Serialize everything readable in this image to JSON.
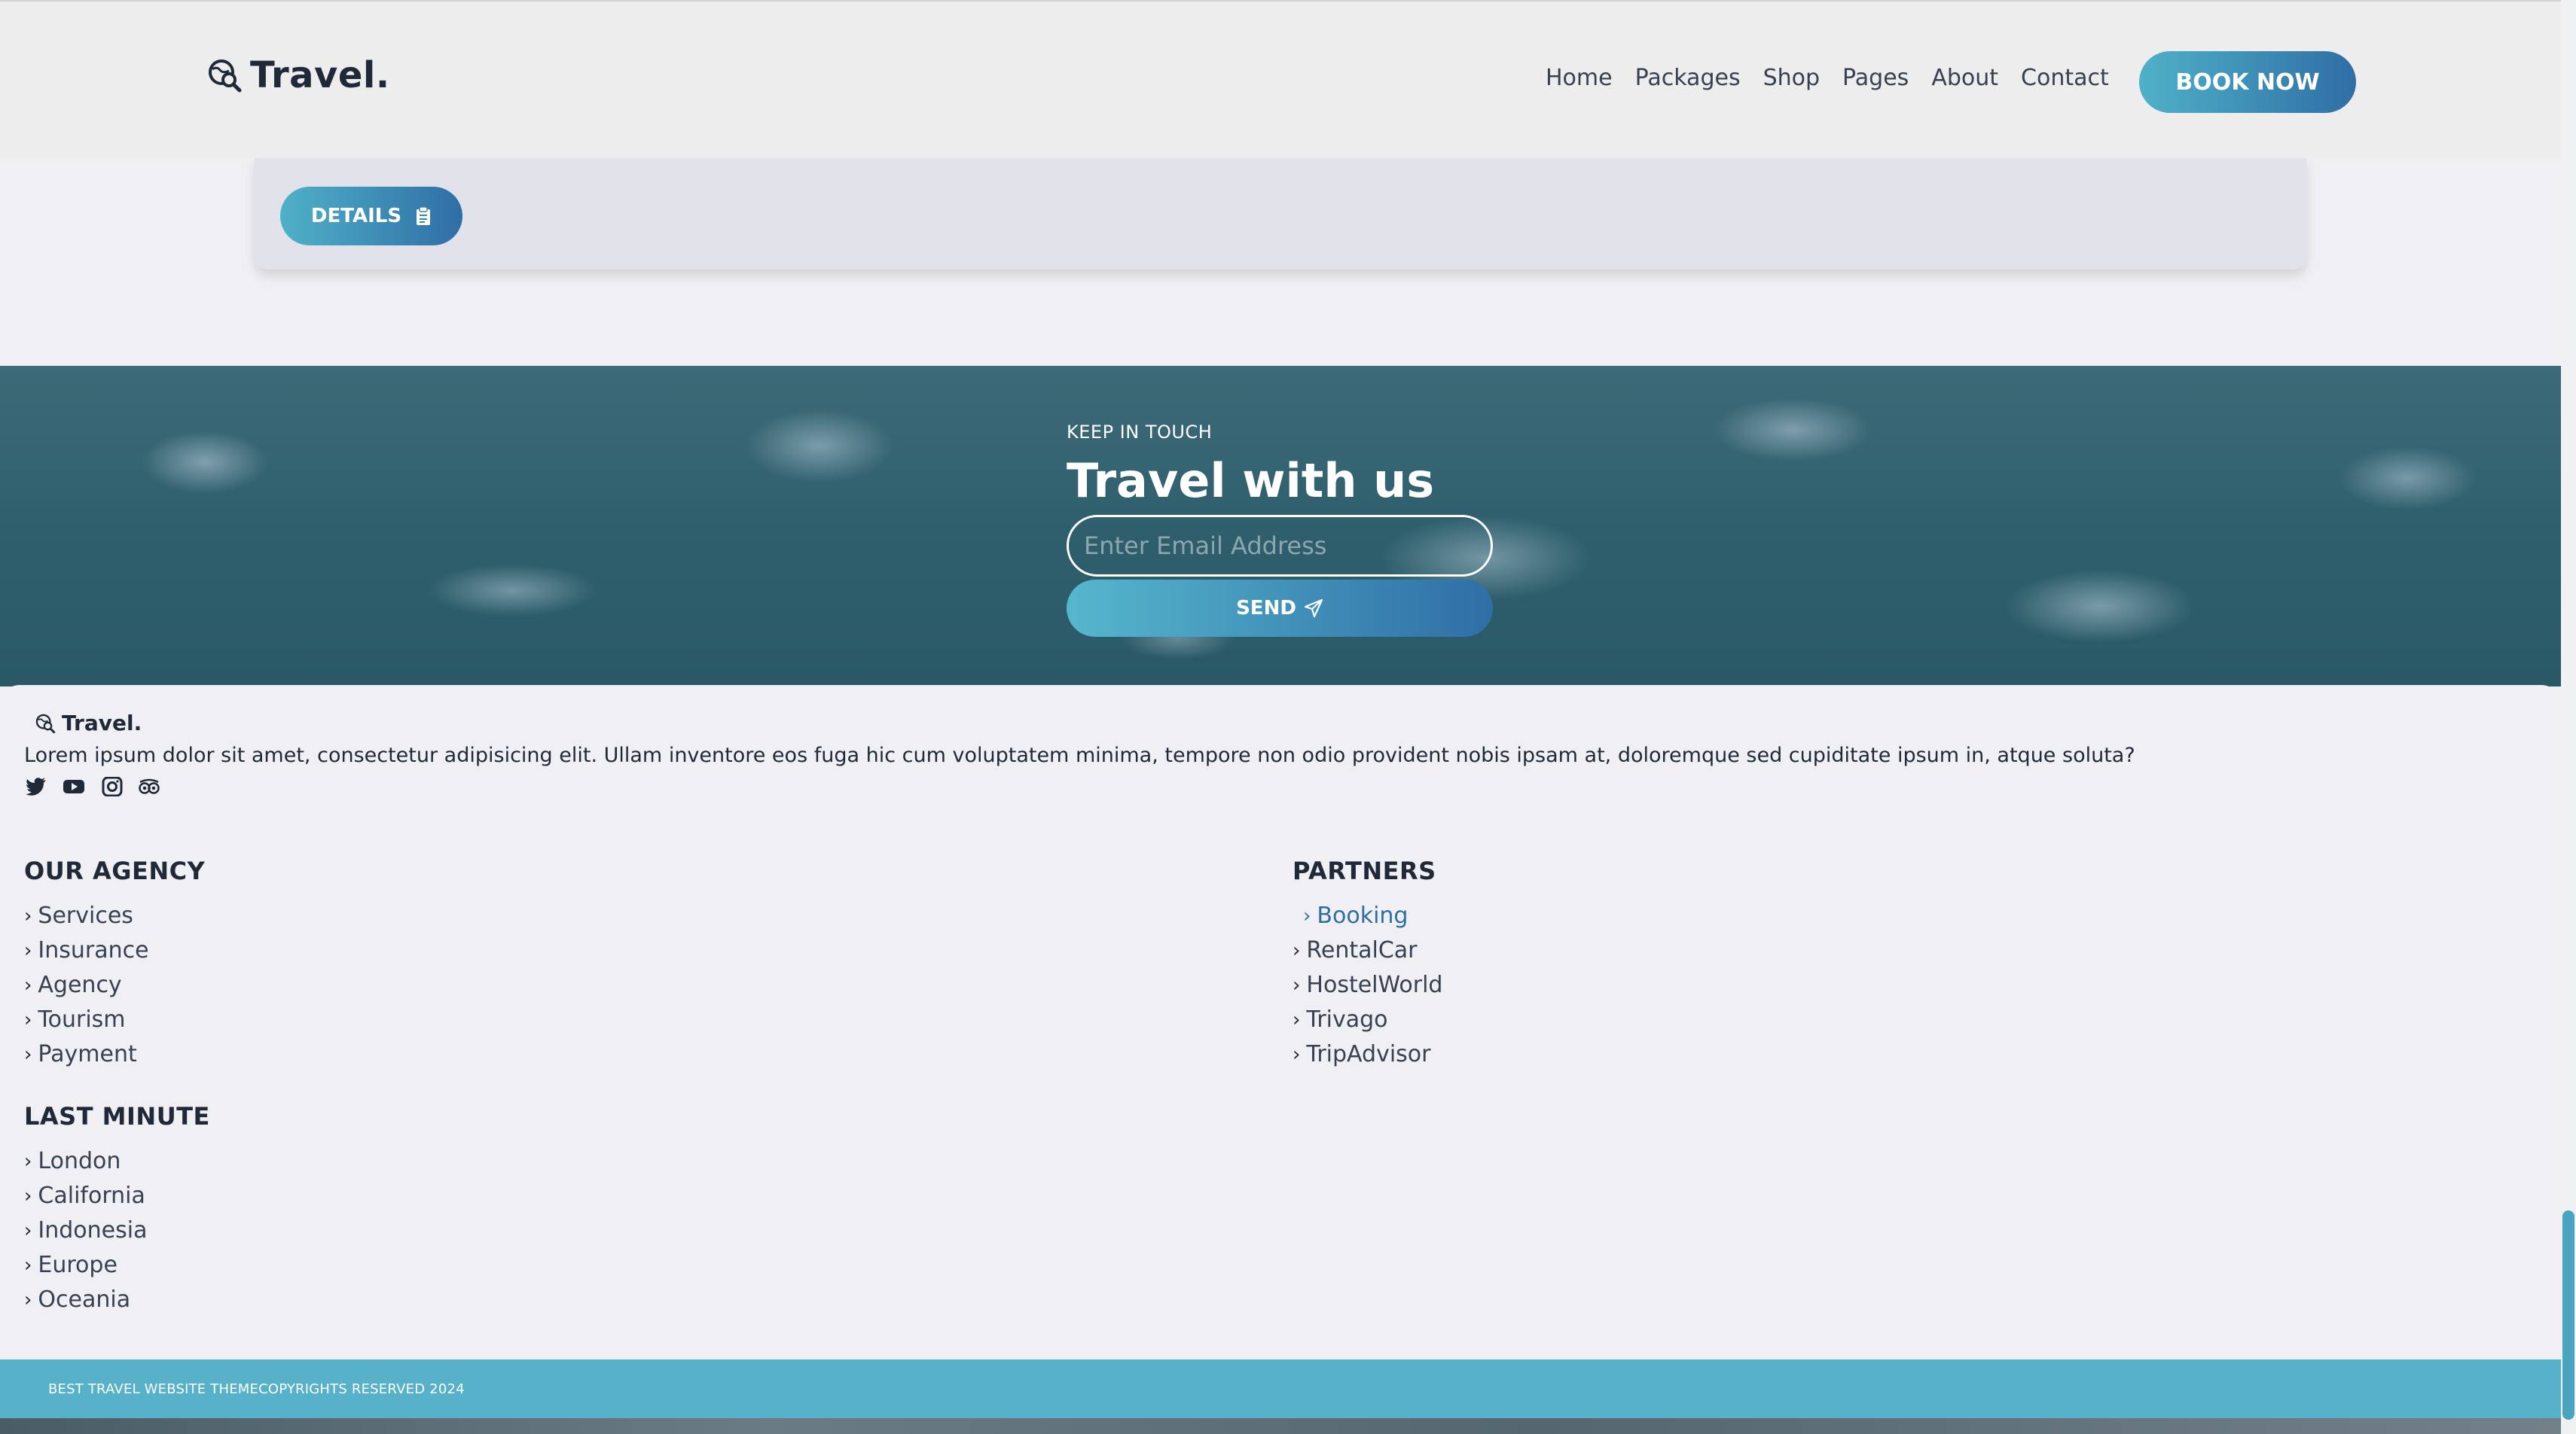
{
  "header": {
    "logo_text": "Travel.",
    "logo_icon": "globe-search-icon",
    "nav": [
      "Home",
      "Packages",
      "Shop",
      "Pages",
      "About",
      "Contact"
    ],
    "book_label": "BOOK NOW"
  },
  "card": {
    "details_label": "DETAILS",
    "details_icon": "clipboard-icon"
  },
  "newsletter": {
    "eyebrow": "KEEP IN TOUCH",
    "title": "Travel with us",
    "email_placeholder": "Enter Email Address",
    "send_label": "SEND",
    "send_icon": "paper-plane-icon"
  },
  "footer": {
    "logo_text": "Travel.",
    "description": "Lorem ipsum dolor sit amet, consectetur adipisicing elit. Ullam inventore eos fuga hic cum voluptatem minima, tempore non odio provident nobis ipsam at, doloremque sed cupiditate ipsum in, atque soluta?",
    "socials": [
      "twitter-icon",
      "youtube-icon",
      "instagram-icon",
      "tripadvisor-icon"
    ],
    "agency": {
      "title": "OUR AGENCY",
      "items": [
        "Services",
        "Insurance",
        "Agency",
        "Tourism",
        "Payment"
      ]
    },
    "partners": {
      "title": "PARTNERS",
      "items": [
        "Booking",
        "RentalCar",
        "HostelWorld",
        "Trivago",
        "TripAdvisor"
      ]
    },
    "last_minute": {
      "title": "LAST MINUTE",
      "items": [
        "London",
        "California",
        "Indonesia",
        "Europe",
        "Oceania"
      ]
    },
    "copyright": "BEST TRAVEL WEBSITE THEMECOPYRIGHTS RESERVED 2024"
  },
  "colors": {
    "accent_start": "#4fb1c8",
    "accent_end": "#2f6ea6",
    "active_link": "#2e6fa3",
    "copyright_bar": "#56b1c9"
  }
}
